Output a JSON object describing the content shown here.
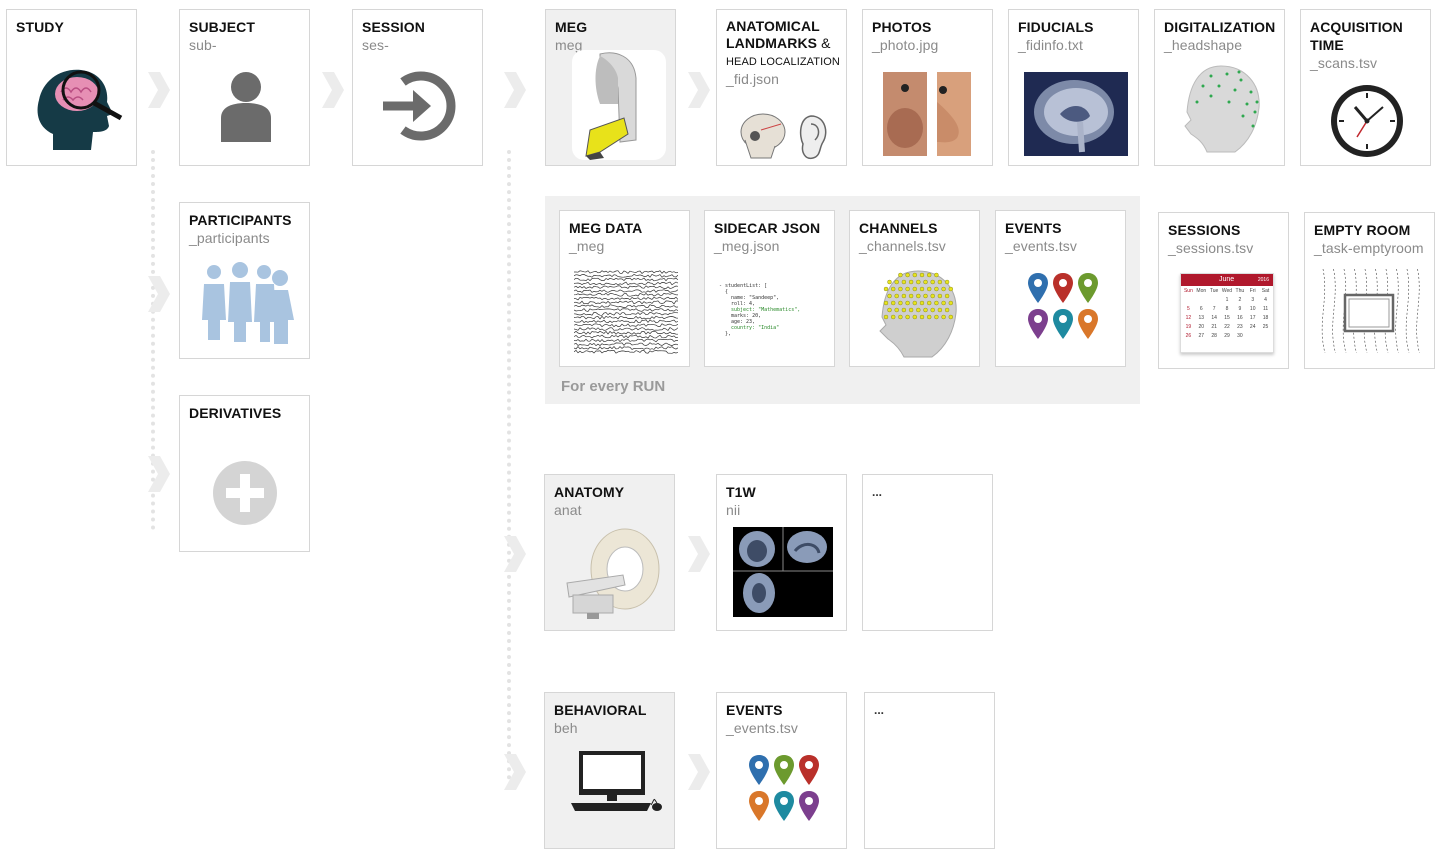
{
  "cards": {
    "study": {
      "title": "STUDY"
    },
    "subject": {
      "title": "SUBJECT",
      "sub": "sub-"
    },
    "session": {
      "title": "SESSION",
      "sub": "ses-"
    },
    "meg": {
      "title": "MEG",
      "sub": "meg"
    },
    "landmarks": {
      "title1": "ANATOMICAL",
      "title2": "LANDMARKS",
      "amp": " &",
      "title3": "HEAD LOCALIZATION",
      "sub": "_fid.json"
    },
    "photos": {
      "title": "PHOTOS",
      "sub": "_photo.jpg"
    },
    "fiducials": {
      "title": "FIDUCIALS",
      "sub": "_fidinfo.txt"
    },
    "digitalization": {
      "title": "DIGITALIZATION",
      "sub": "_headshape"
    },
    "acquisition": {
      "title1": "ACQUISITION",
      "title2": "TIME",
      "sub": "_scans.tsv"
    },
    "participants": {
      "title": "PARTICIPANTS",
      "sub": "_participants"
    },
    "derivatives": {
      "title": "DERIVATIVES"
    },
    "megdata": {
      "title": "MEG DATA",
      "sub": "_meg"
    },
    "sidecar": {
      "title": "SIDECAR JSON",
      "sub": "_meg.json"
    },
    "channels": {
      "title": "CHANNELS",
      "sub": "_channels.tsv"
    },
    "events_run": {
      "title": "EVENTS",
      "sub": "_events.tsv"
    },
    "sessions": {
      "title": "SESSIONS",
      "sub": "_sessions.tsv"
    },
    "emptyroom": {
      "title": "EMPTY ROOM",
      "sub": "_task-emptyroom"
    },
    "anatomy": {
      "title": "ANATOMY",
      "sub": "anat"
    },
    "t1w": {
      "title": "T1W",
      "sub": "nii"
    },
    "anat_more": {
      "title": "..."
    },
    "behavioral": {
      "title": "BEHAVIORAL",
      "sub": "beh"
    },
    "events_beh": {
      "title": "EVENTS",
      "sub": "_events.tsv"
    },
    "beh_more": {
      "title": "..."
    }
  },
  "run_label": "For every RUN",
  "json_snippet": [
    "- studentList: [",
    "{",
    "name: \"Sandeep\",",
    "roll: 4,",
    "subject: \"Mathematics\",",
    "marks: 20,",
    "age: 23,",
    "country: \"India\"",
    "},"
  ],
  "calendar": {
    "month": "June",
    "year": "2016",
    "days": [
      "Sun",
      "Mon",
      "Tue",
      "Wed",
      "Thu",
      "Fri",
      "Sat"
    ]
  },
  "colors": {
    "card_border": "#d6d6d6",
    "grey_card": "#f0f0f0",
    "chevron": "#ececec",
    "pin_blue": "#2f6fae",
    "pin_red": "#b9302a",
    "pin_green": "#6c9a2e",
    "pin_purple": "#7c3f8e",
    "pin_teal": "#1e8aa0",
    "pin_orange": "#d9772a"
  }
}
